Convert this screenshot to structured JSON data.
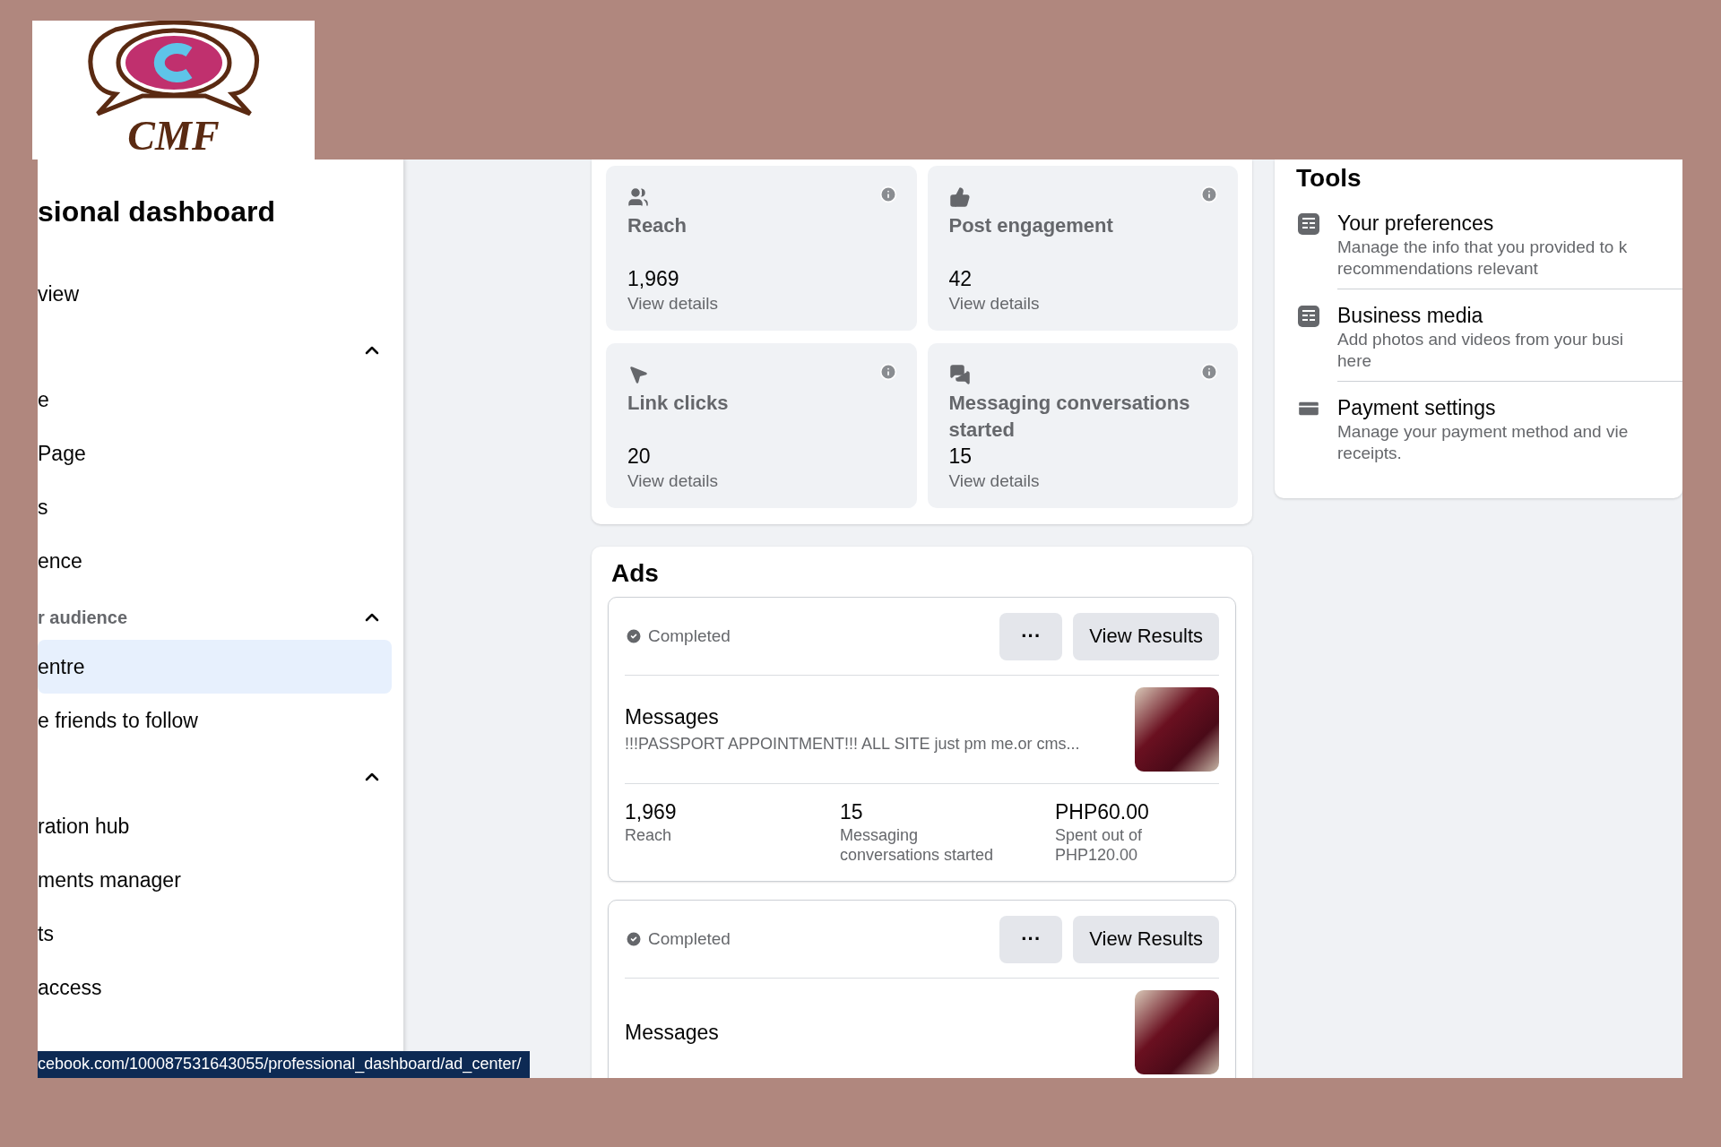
{
  "logo": {
    "text": "CMF"
  },
  "sidebar": {
    "title": "sional dashboard",
    "items": [
      {
        "kind": "item",
        "label": "view",
        "selected": false
      },
      {
        "kind": "section",
        "expanded": true
      },
      {
        "kind": "item",
        "label": "e",
        "selected": false
      },
      {
        "kind": "item",
        "label": "Page",
        "selected": false
      },
      {
        "kind": "item",
        "label": "s",
        "selected": false
      },
      {
        "kind": "item",
        "label": "ence",
        "selected": false
      },
      {
        "kind": "section",
        "label": "r audience",
        "expanded": true
      },
      {
        "kind": "item",
        "label": "entre",
        "selected": true
      },
      {
        "kind": "item",
        "label": "e friends to follow",
        "selected": false
      },
      {
        "kind": "section",
        "expanded": true
      },
      {
        "kind": "item",
        "label": "ration hub",
        "selected": false
      },
      {
        "kind": "item",
        "label": "ments manager",
        "selected": false
      },
      {
        "kind": "item",
        "label": "ts",
        "selected": false
      },
      {
        "kind": "item",
        "label": "access",
        "selected": false
      }
    ]
  },
  "metrics": [
    {
      "label": "Reach",
      "value": "1,969",
      "link": "View details"
    },
    {
      "label": "Post engagement",
      "value": "42",
      "link": "View details"
    },
    {
      "label": "Link clicks",
      "value": "20",
      "link": "View details"
    },
    {
      "label": "Messaging conversations started",
      "value": "15",
      "link": "View details"
    }
  ],
  "ads": {
    "title": "Ads",
    "cards": [
      {
        "status": "Completed",
        "more": "···",
        "action": "View Results",
        "name": "Messages",
        "description": "!!!PASSPORT APPOINTMENT!!! ALL SITE just pm me.or cms...",
        "stats": [
          {
            "value": "1,969",
            "label": "Reach"
          },
          {
            "value": "15",
            "label": "Messaging conversations started"
          },
          {
            "value": "PHP60.00",
            "label": "Spent out of PHP120.00"
          }
        ]
      },
      {
        "status": "Completed",
        "more": "···",
        "action": "View Results",
        "name": "Messages"
      }
    ]
  },
  "tools": {
    "title": "Tools",
    "items": [
      {
        "title": "Your preferences",
        "description": "Manage the info that you provided to k recommendations relevant"
      },
      {
        "title": "Business media",
        "description": "Add photos and videos from your busi here"
      },
      {
        "title": "Payment settings",
        "description": "Manage your payment method and vie receipts."
      }
    ]
  },
  "status_bar": {
    "url": "cebook.com/100087531643055/professional_dashboard/ad_center/"
  }
}
